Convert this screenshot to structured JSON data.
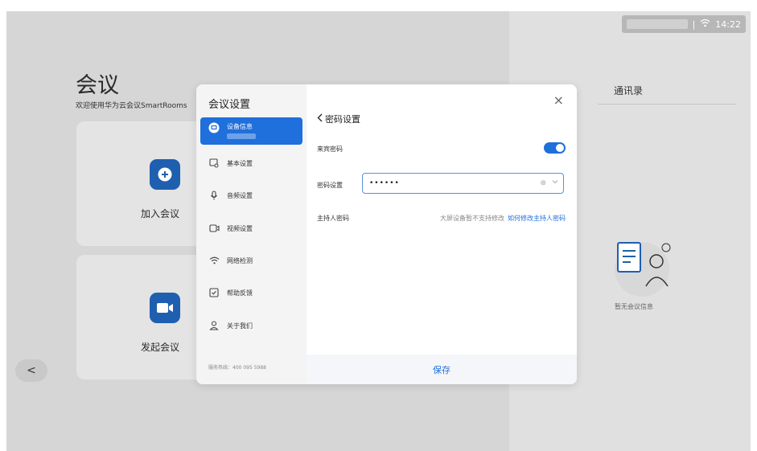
{
  "status_bar": {
    "separator": "|",
    "time": "14:22"
  },
  "app": {
    "title": "会议",
    "welcome": "欢迎使用华为云会议SmartRooms",
    "cards": [
      {
        "label": "加入会议",
        "icon": "plus-icon"
      },
      {
        "label": "发起会议",
        "icon": "video-camera-icon"
      }
    ],
    "contacts_tab": "通讯录",
    "empty_text": "暂无会议信息",
    "back": "<"
  },
  "modal": {
    "title": "会议设置",
    "sidebar": {
      "items": [
        {
          "label": "设备信息",
          "icon": "device-icon",
          "active": true
        },
        {
          "label": "基本设置",
          "icon": "basic-settings-icon"
        },
        {
          "label": "音频设置",
          "icon": "microphone-icon"
        },
        {
          "label": "视频设置",
          "icon": "video-icon"
        },
        {
          "label": "网络检测",
          "icon": "wifi-icon"
        },
        {
          "label": "帮助反馈",
          "icon": "feedback-icon"
        },
        {
          "label": "关于我们",
          "icon": "user-icon"
        }
      ],
      "hotline": "服务热线：400 095 5988"
    },
    "main": {
      "close": "×",
      "back_label": "密码设置",
      "guest_password_label": "来宾密码",
      "guest_password_enabled": true,
      "password_label": "密码设置",
      "password_value": "••••••",
      "host_password_label": "主持人密码",
      "host_note": "大屏设备暂不支持修改",
      "host_link": "如何修改主持人密码",
      "save": "保存"
    }
  },
  "colors": {
    "accent": "#1f6fdc",
    "overlay": "#d6d6d6",
    "card_icon": "#1f5fb0"
  }
}
